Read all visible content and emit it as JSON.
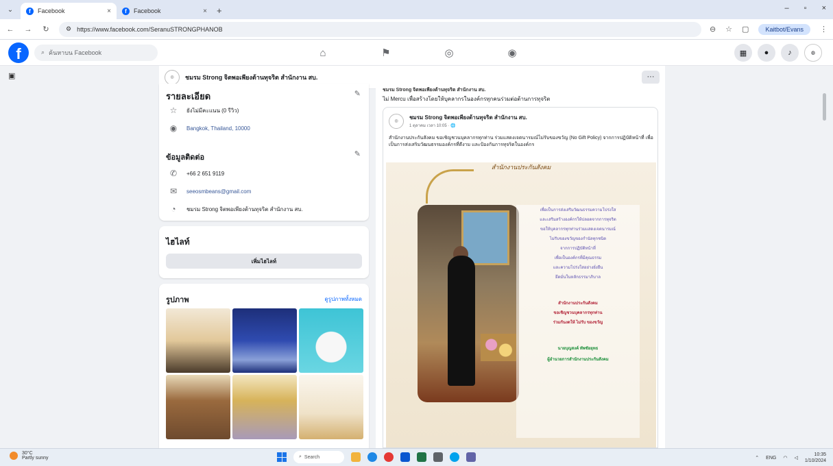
{
  "browser": {
    "tabs": [
      {
        "title": "Facebook",
        "active": true
      },
      {
        "title": "Facebook",
        "active": false
      }
    ],
    "url": "https://www.facebook.com/SeranuSTRONGPHANOB",
    "profile_label": "Kaitbot/Evans"
  },
  "fb": {
    "search_placeholder": "ค้นหาบน Facebook",
    "center_icons": [
      "home-icon",
      "pages-icon",
      "marketplace-icon",
      "gaming-icon"
    ]
  },
  "page": {
    "name": "ชมรม Strong จิตพอเพียงต้านทุจริต สำนักงาน สบ.",
    "more_label": "···"
  },
  "about": {
    "title": "รายละเอียด",
    "rows": [
      {
        "icon": "star-icon",
        "text": "ยังไม่มีคะแนน (0 รีวิว)"
      },
      {
        "icon": "location-icon",
        "text": "Bangkok, Thailand, 10000"
      }
    ],
    "contact_title": "ข้อมูลติดต่อ",
    "contact_rows": [
      {
        "icon": "phone-icon",
        "text": "+66 2 651 9119"
      },
      {
        "icon": "email-icon",
        "text": "seeosmbeans@gmail.com"
      },
      {
        "icon": "messenger-icon",
        "text": "ชมรม Strong จิตพอเพียงต้านทุจริต สำนักงาน สบ."
      }
    ]
  },
  "highlights": {
    "title": "ไฮไลท์",
    "button": "เพิ่มไฮไลท์"
  },
  "photos": {
    "title": "รูปภาพ",
    "see_all": "ดูรูปภาพทั้งหมด"
  },
  "post": {
    "line1": "ชมรม Strong จิตพอเพียงต้านทุจริต สำนักงาน สบ.",
    "line2": "ไม่ Mercu เพื่อสร้างโดยให้บุคลากรในองค์กรทุกคนร่วมต่อต้านการทุจริต",
    "shared_name": "ชมรม Strong จิตพอเพียงต้านทุจริต สำนักงาน สบ.",
    "shared_meta": "1 ตุลาคม เวลา 10:05 · 🌐",
    "shared_text": "สำนักงานประกันสังคม ขอเชิญชวนบุคลากรทุกท่าน ร่วมแสดงเจตนารมณ์ไม่รับของขวัญ (No Gift Policy) จากการปฏิบัติหน้าที่ เพื่อเป็นการส่งเสริมวัฒนธรรมองค์กรที่ดีงาม และป้องกันการทุจริตในองค์กร",
    "poster_band": "สำนักงานประกันสังคม",
    "poster_lines": [
      "เพื่อเป็นการส่งเสริมวัฒนธรรมความโปร่งใส",
      "และเสริมสร้างองค์กรให้ปลอดจากการทุจริต",
      "ขอให้บุคลากรทุกท่านร่วมแสดงเจตนารมณ์",
      "ไม่รับของขวัญของกำนัลทุกชนิด",
      "จากการปฏิบัติหน้าที่",
      "เพื่อเป็นองค์กรที่มีคุณธรรม",
      "และความโปร่งใสอย่างยั่งยืน",
      "ยึดมั่นในหลักธรรมาภิบาล"
    ],
    "poster_red": [
      "สำนักงานประกันสังคม",
      "ขอเชิญชวนบุคลากรทุกท่าน",
      "ร่วมกันงดให้ ไม่รับ ของขวัญ"
    ],
    "poster_green": [
      "นายบุญสงค์ ทัพชัยยุทธ",
      "ผู้อำนวยการสำนักงานประกันสังคม"
    ]
  },
  "taskbar": {
    "weather_temp": "30°C",
    "weather_desc": "Partly sunny",
    "search": "Search",
    "lang": "ENG",
    "time": "10:35",
    "date": "1/10/2024"
  }
}
